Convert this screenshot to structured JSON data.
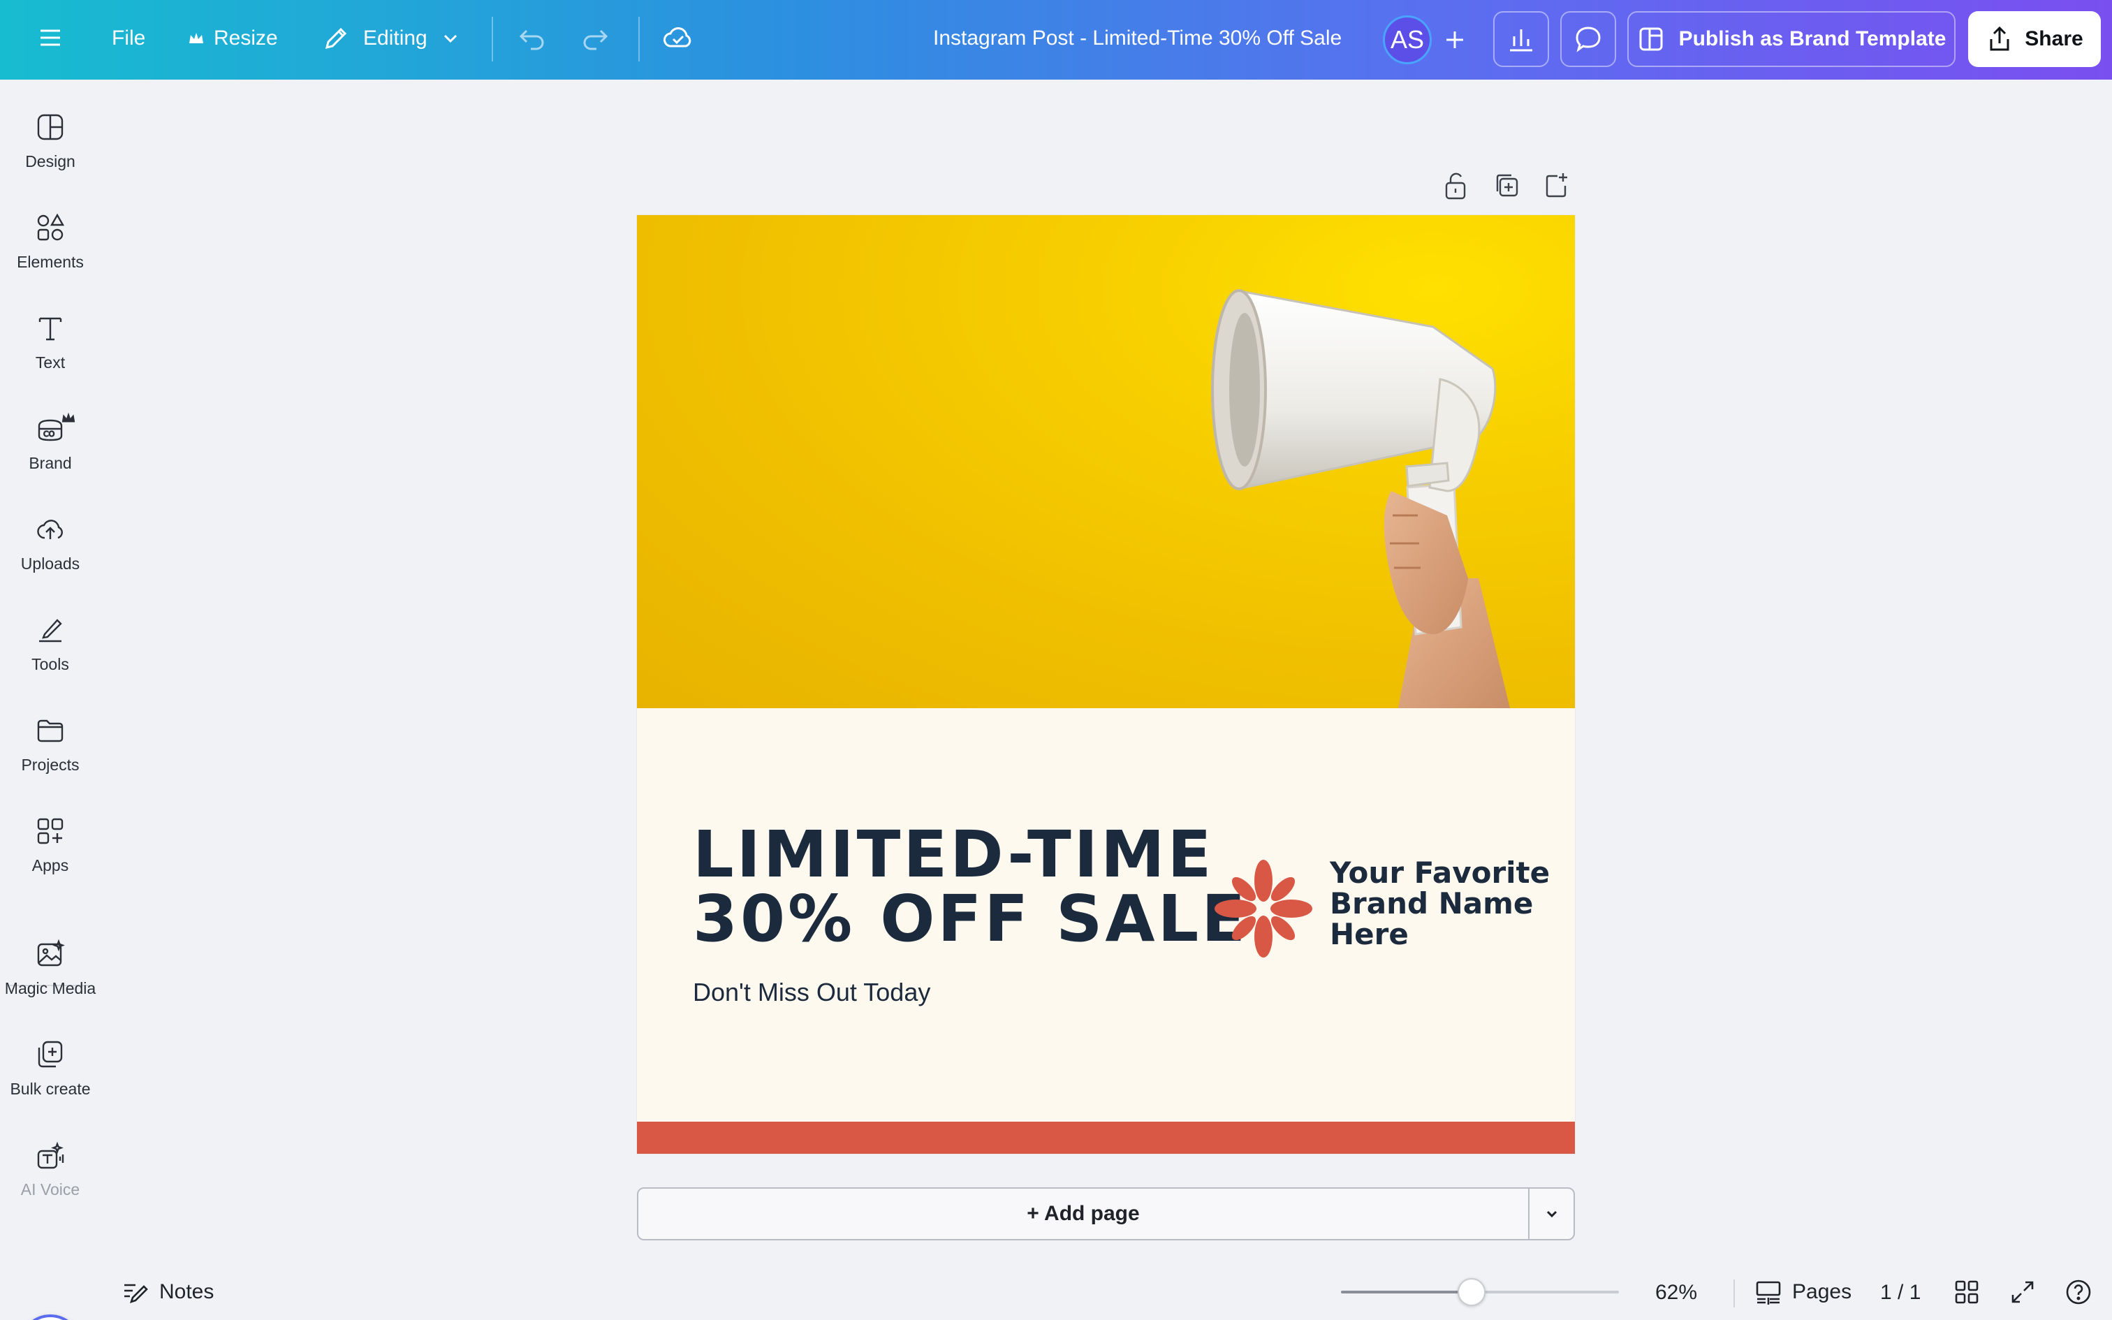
{
  "topbar": {
    "menu_icon": "hamburger-icon",
    "file_label": "File",
    "resize_label": "Resize",
    "editing_label": "Editing",
    "document_title": "Instagram Post - Limited-Time 30% Off Sale",
    "avatar_initials": "AS",
    "publish_label": "Publish as Brand Template",
    "share_label": "Share"
  },
  "sidebar": {
    "items": [
      {
        "label": "Design",
        "icon": "design-icon"
      },
      {
        "label": "Elements",
        "icon": "elements-icon"
      },
      {
        "label": "Text",
        "icon": "text-icon"
      },
      {
        "label": "Brand",
        "icon": "brand-icon"
      },
      {
        "label": "Uploads",
        "icon": "uploads-icon"
      },
      {
        "label": "Tools",
        "icon": "tools-icon"
      },
      {
        "label": "Projects",
        "icon": "projects-icon"
      },
      {
        "label": "Apps",
        "icon": "apps-icon"
      },
      {
        "label": "Magic Media",
        "icon": "magic-media-icon"
      },
      {
        "label": "Bulk create",
        "icon": "bulk-create-icon"
      },
      {
        "label": "AI Voice",
        "icon": "ai-voice-icon"
      }
    ]
  },
  "design": {
    "headline_line1": "LIMITED-TIME",
    "headline_line2": "30% OFF SALE",
    "subline": "Don't Miss Out Today",
    "brand_line1": "Your Favorite",
    "brand_line2": "Brand Name",
    "brand_line3": "Here",
    "colors": {
      "photo_bg": "#f2c400",
      "page_bg": "#fef9ee",
      "accent": "#d95745",
      "text": "#1c2a3e"
    }
  },
  "add_page_label": "+ Add page",
  "footer": {
    "notes_label": "Notes",
    "zoom_percent": "62%",
    "zoom_level": 0.47,
    "pages_label": "Pages",
    "page_count": "1 / 1"
  }
}
